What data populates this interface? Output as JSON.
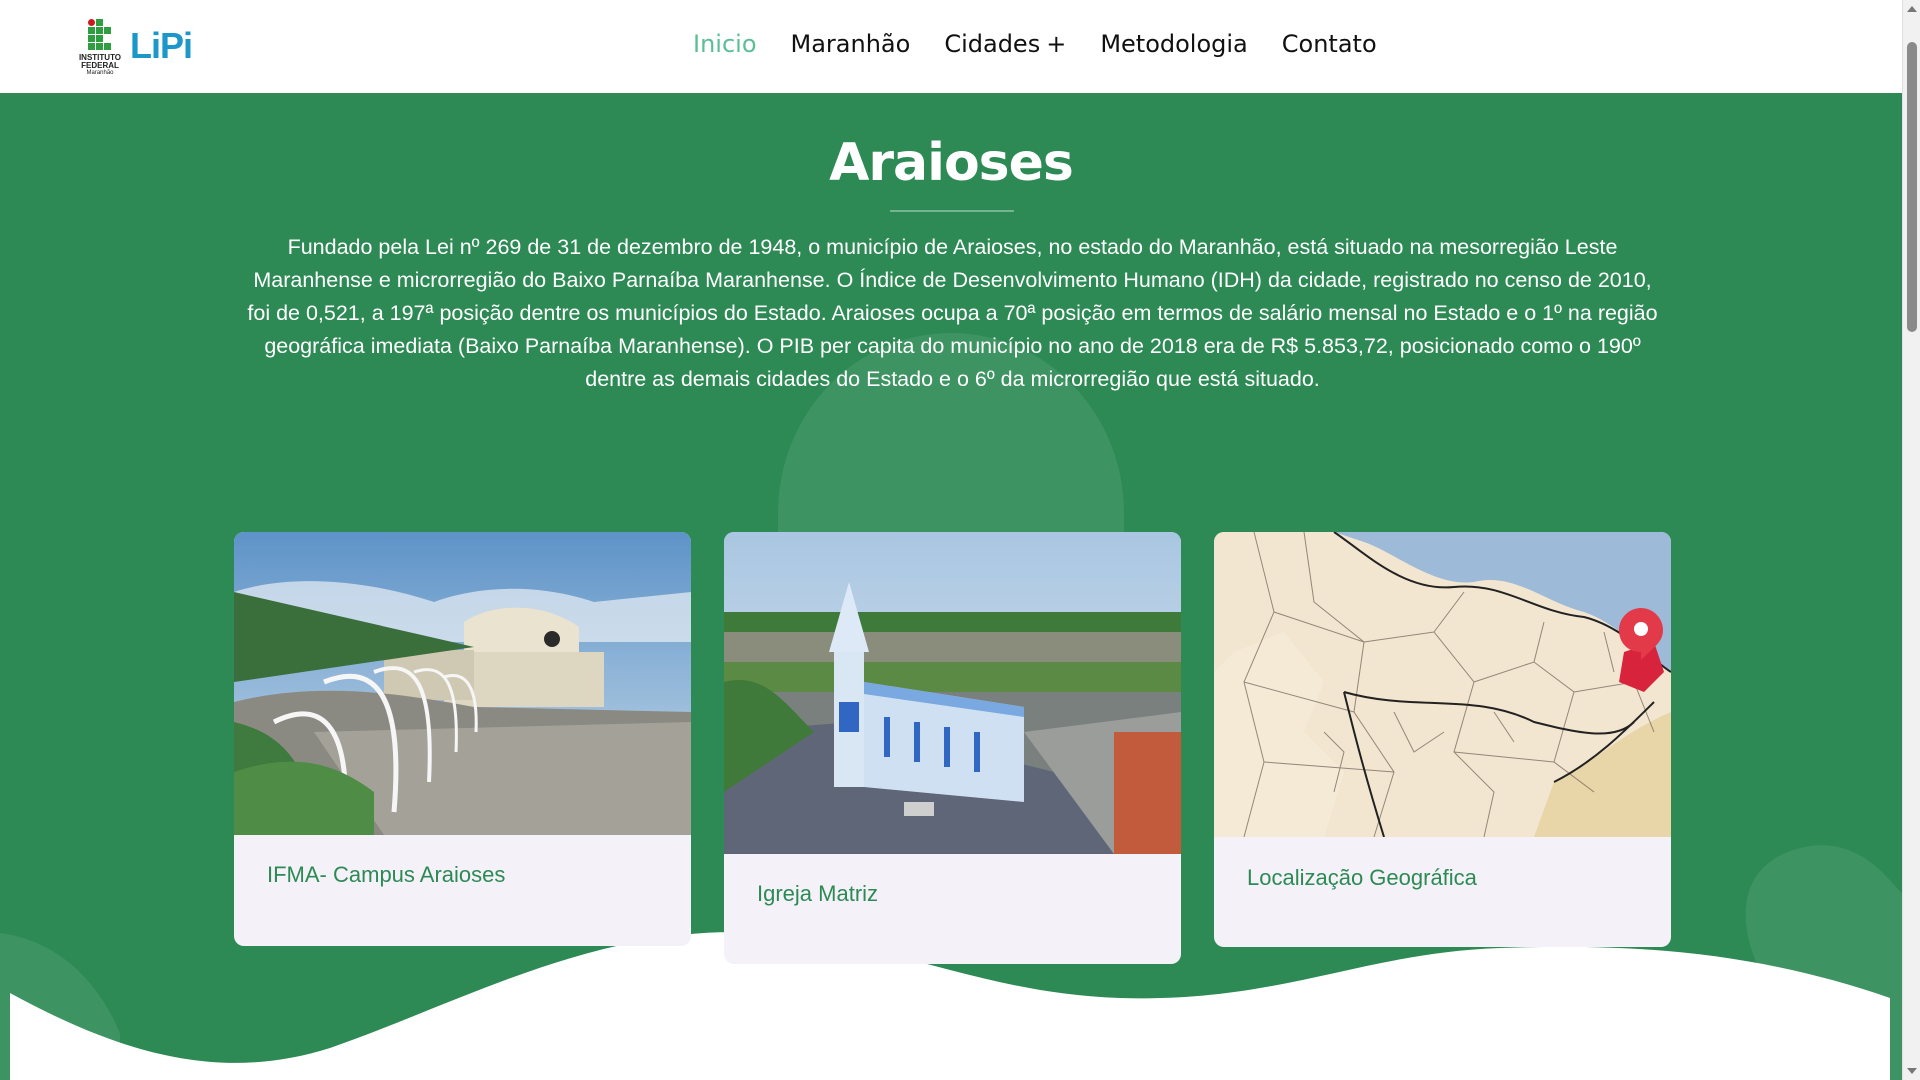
{
  "header": {
    "logo_if_lines": [
      "INSTITUTO",
      "FEDERAL",
      "Maranhão"
    ],
    "logo_text": "LiPi",
    "nav": [
      {
        "label": "Inicio",
        "active": true
      },
      {
        "label": "Maranhão"
      },
      {
        "label": "Cidades",
        "suffix": "+"
      },
      {
        "label": "Metodologia"
      },
      {
        "label": "Contato"
      }
    ]
  },
  "hero": {
    "title": "Araioses",
    "description": "Fundado pela Lei nº 269 de 31 de dezembro de 1948, o município de Araioses, no estado do Maranhão, está situado na mesorregião Leste Maranhense e microrregião do Baixo Parnaíba Maranhense. O Índice de Desenvolvimento Humano (IDH) da cidade, registrado no censo de 2010, foi de 0,521, a 197ª posição dentre os municípios do Estado. Araioses ocupa a 70ª posição em termos de salário mensal no Estado e o 1º na região geográfica imediata (Baixo Parnaíba Maranhense). O PIB per capita do município no ano de 2018 era de R$ 5.853,72, posicionado como o 190º dentre as demais cidades do Estado e o 6º da microrregião que está situado."
  },
  "cards": [
    {
      "label": "IFMA- Campus Araioses"
    },
    {
      "label": "Igreja Matriz"
    },
    {
      "label": "Localização Geográfica"
    }
  ],
  "colors": {
    "primary_green": "#2d8a55",
    "nav_active": "#5bbf95",
    "card_bg": "#f4f2f8",
    "logo_blue": "#1b97c9"
  }
}
